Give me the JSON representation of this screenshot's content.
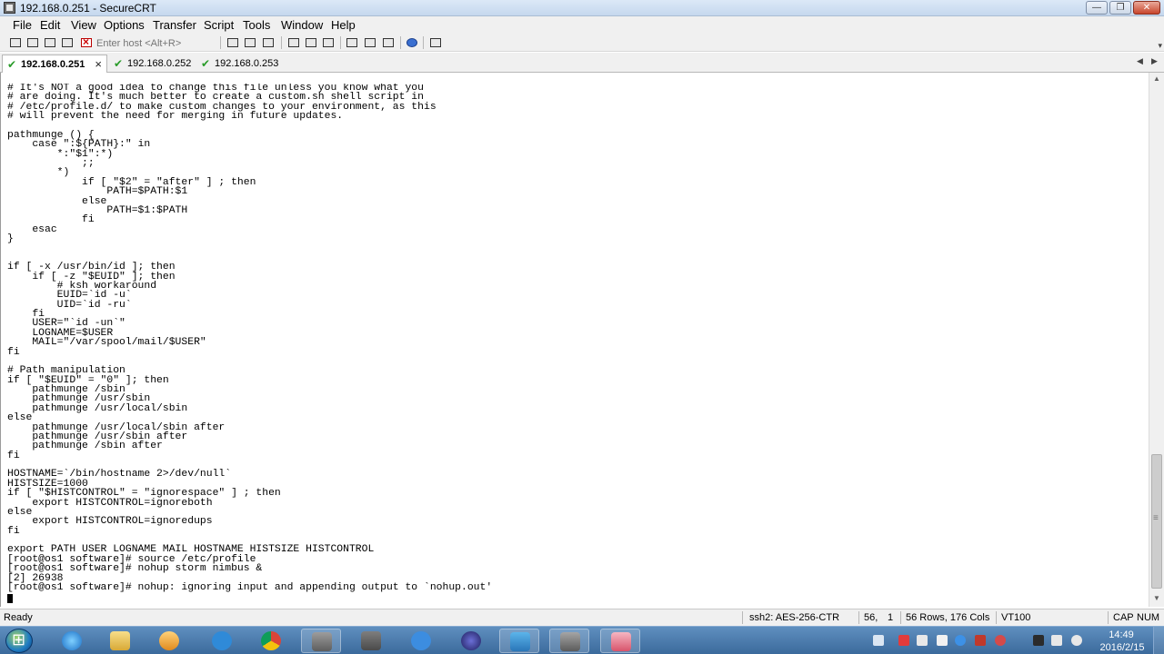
{
  "window": {
    "title": "192.168.0.251 - SecureCRT",
    "minimize_glyph": "—",
    "restore_glyph": "❐",
    "close_glyph": "✕"
  },
  "menu": [
    "File",
    "Edit",
    "View",
    "Options",
    "Transfer",
    "Script",
    "Tools",
    "Window",
    "Help"
  ],
  "toolbar": {
    "host_placeholder": "Enter host <Alt+R>"
  },
  "tabs": [
    {
      "label": "192.168.0.251",
      "active": true
    },
    {
      "label": "192.168.0.252",
      "active": false
    },
    {
      "label": "192.168.0.253",
      "active": false
    }
  ],
  "terminal": {
    "lines": [
      "# It's NOT a good idea to change this file unless you know what you",
      "# are doing. It's much better to create a custom.sh shell script in",
      "# /etc/profile.d/ to make custom changes to your environment, as this",
      "# will prevent the need for merging in future updates.",
      "",
      "pathmunge () {",
      "    case \":${PATH}:\" in",
      "        *:\"$1\":*)",
      "            ;;",
      "        *)",
      "            if [ \"$2\" = \"after\" ] ; then",
      "                PATH=$PATH:$1",
      "            else",
      "                PATH=$1:$PATH",
      "            fi",
      "    esac",
      "}",
      "",
      "",
      "if [ -x /usr/bin/id ]; then",
      "    if [ -z \"$EUID\" ]; then",
      "        # ksh workaround",
      "        EUID=`id -u`",
      "        UID=`id -ru`",
      "    fi",
      "    USER=\"`id -un`\"",
      "    LOGNAME=$USER",
      "    MAIL=\"/var/spool/mail/$USER\"",
      "fi",
      "",
      "# Path manipulation",
      "if [ \"$EUID\" = \"0\" ]; then",
      "    pathmunge /sbin",
      "    pathmunge /usr/sbin",
      "    pathmunge /usr/local/sbin",
      "else",
      "    pathmunge /usr/local/sbin after",
      "    pathmunge /usr/sbin after",
      "    pathmunge /sbin after",
      "fi",
      "",
      "HOSTNAME=`/bin/hostname 2>/dev/null`",
      "HISTSIZE=1000",
      "if [ \"$HISTCONTROL\" = \"ignorespace\" ] ; then",
      "    export HISTCONTROL=ignoreboth",
      "else",
      "    export HISTCONTROL=ignoredups",
      "fi",
      "",
      "export PATH USER LOGNAME MAIL HOSTNAME HISTSIZE HISTCONTROL",
      "[root@os1 software]# source /etc/profile",
      "[root@os1 software]# nohup storm nimbus &",
      "[2] 26938",
      "[root@os1 software]# nohup: ignoring input and appending output to `nohup.out'"
    ]
  },
  "status": {
    "ready": "Ready",
    "cipher": "ssh2: AES-256-CTR",
    "row": "56,",
    "col": "1",
    "size": "56 Rows, 176 Cols",
    "term": "VT100",
    "cap": "CAP",
    "num": "NUM"
  },
  "taskbar": {
    "time": "14:49",
    "date": "2016/2/15"
  },
  "colors": {
    "accent": "#3b6a9c",
    "tab_check": "#2a9c2a"
  }
}
